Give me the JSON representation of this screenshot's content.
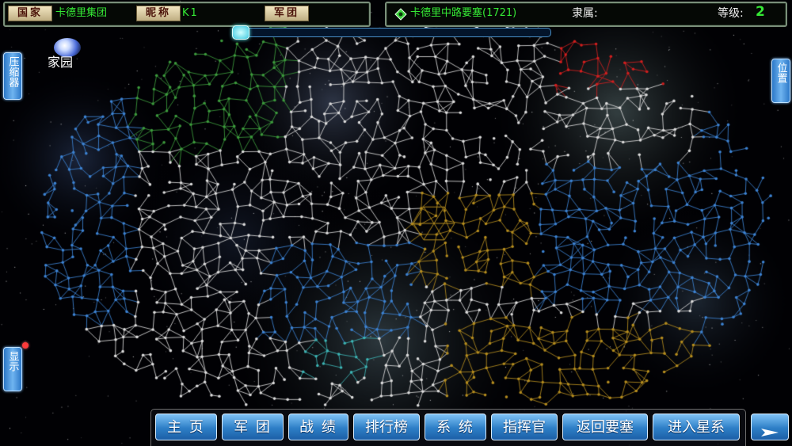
{
  "top_left_panel": {
    "country_tag": "国家",
    "country_name": "卡德里集团",
    "nickname_tag": "昵称",
    "nickname_value": "K1",
    "legion_tag": "军团"
  },
  "top_right_panel": {
    "location_name": "卡德里中路要塞(1721)",
    "affiliation_label": "隶属:",
    "level_label": "等级:",
    "level_value": "2"
  },
  "home": {
    "label": "家园"
  },
  "side_tabs": {
    "left_top": "压缩器",
    "left_bottom": "显示",
    "right_top": "位置"
  },
  "nav": {
    "items": [
      "主 页",
      "军 团",
      "战 绩",
      "排行榜",
      "系 统",
      "指挥官",
      "返回要塞",
      "进入星系"
    ],
    "arrow_icon": "play-arrow-icon"
  },
  "map": {
    "territory_colors": {
      "neutral": "#dcdcdc",
      "blue_faction": "#3c82d2",
      "gold_faction": "#b48c1e",
      "green_faction": "#3c9a3c",
      "red_faction": "#d21e1e",
      "cyan_faction": "#3cb4b4"
    }
  },
  "colors": {
    "green_text": "#35e835",
    "tab_blue": "#2c78c8",
    "level_green": "#35e835"
  }
}
